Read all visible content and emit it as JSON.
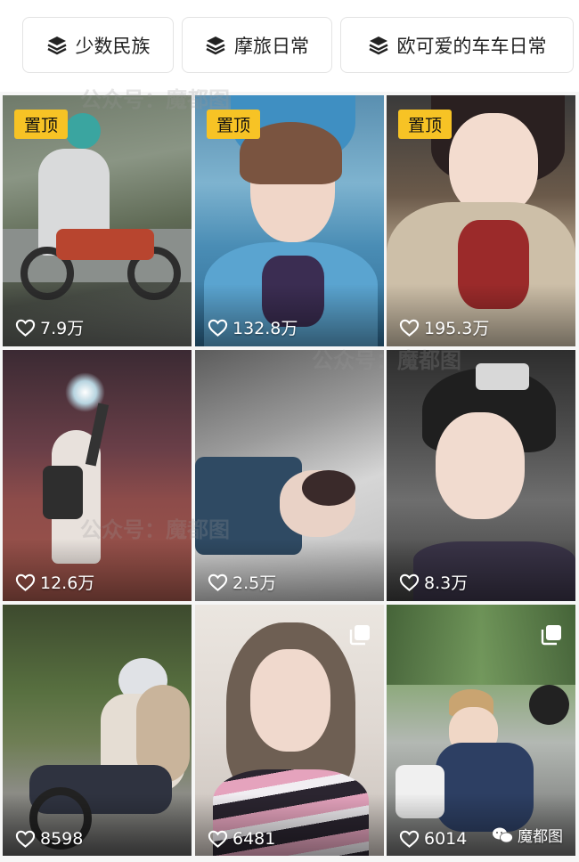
{
  "tabs": [
    {
      "label": "少数民族",
      "icon": "layers-icon"
    },
    {
      "label": "摩旅日常",
      "icon": "layers-icon"
    },
    {
      "label": "欧可爱的车车日常",
      "icon": "layers-icon"
    }
  ],
  "pinned_label": "置顶",
  "videos": [
    {
      "likes": "7.9万",
      "pinned": true
    },
    {
      "likes": "132.8万",
      "pinned": true
    },
    {
      "likes": "195.3万",
      "pinned": true
    },
    {
      "likes": "12.6万",
      "pinned": false
    },
    {
      "likes": "2.5万",
      "pinned": false
    },
    {
      "likes": "8.3万",
      "pinned": false
    },
    {
      "likes": "8598",
      "pinned": false
    },
    {
      "likes": "6481",
      "pinned": false,
      "multi_image": true
    },
    {
      "likes": "6014",
      "pinned": false,
      "multi_image": true
    }
  ],
  "watermark": {
    "brand": "魔都图",
    "text_a": "公众号",
    "text_b": "魔都图"
  },
  "colors": {
    "pin_badge": "#f7c325",
    "page_bg": "#f6f6f6"
  }
}
